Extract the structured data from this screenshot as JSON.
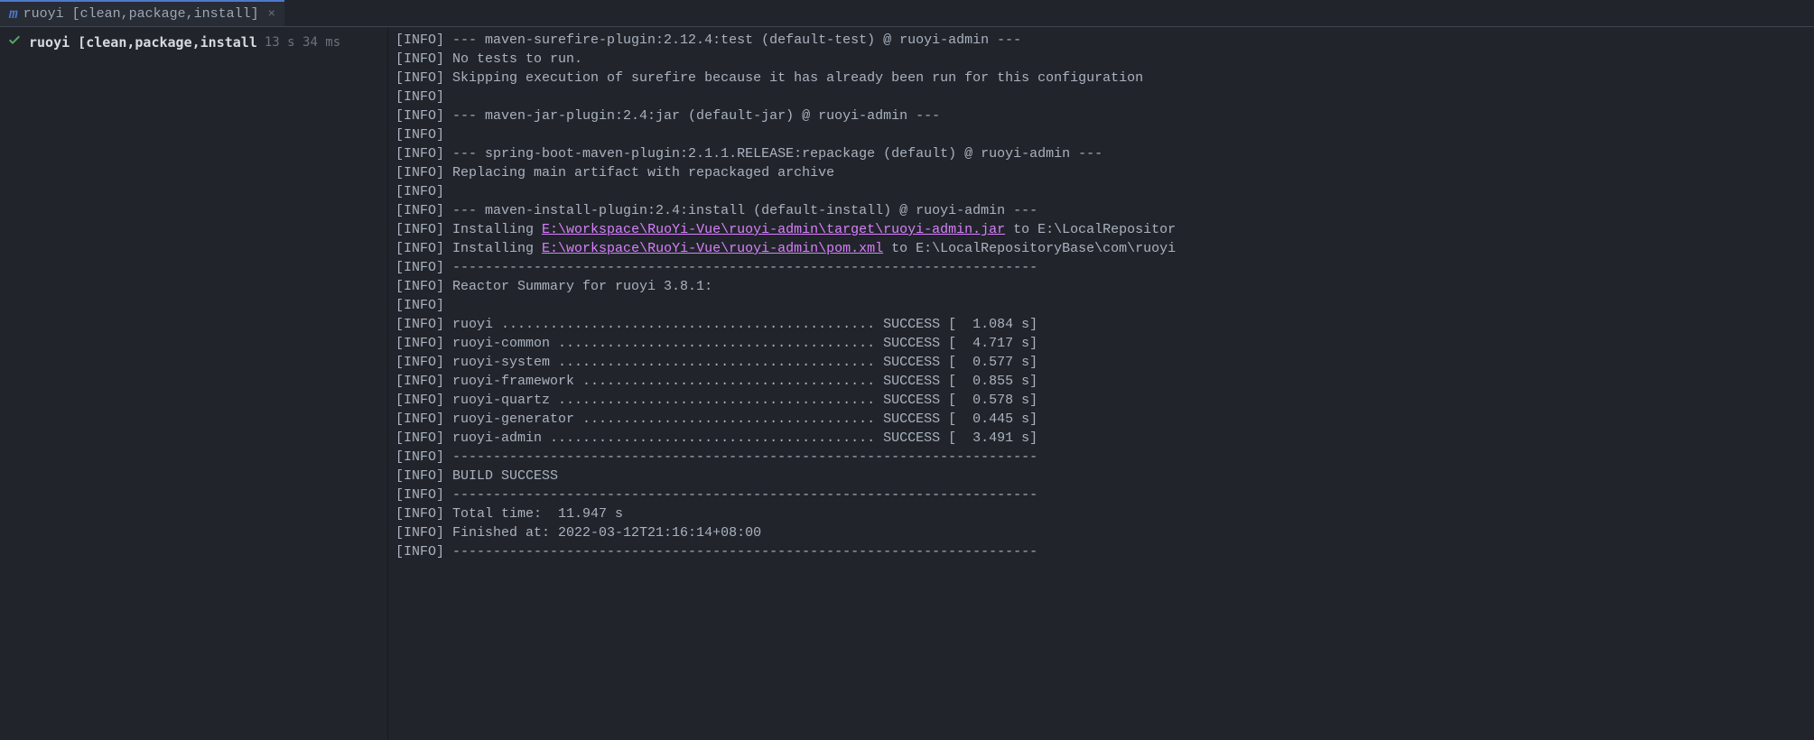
{
  "tab": {
    "title": "ruoyi [clean,package,install]",
    "close": "×"
  },
  "sidebar": {
    "run": {
      "name": "ruoyi [clean,package,install",
      "time": "13 s 34 ms"
    }
  },
  "console": {
    "lines": [
      {
        "tag": "[INFO]",
        "text": " --- maven-surefire-plugin:2.12.4:test (default-test) @ ruoyi-admin ---"
      },
      {
        "tag": "[INFO]",
        "text": " No tests to run."
      },
      {
        "tag": "[INFO]",
        "text": " Skipping execution of surefire because it has already been run for this configuration"
      },
      {
        "tag": "[INFO]",
        "text": ""
      },
      {
        "tag": "[INFO]",
        "text": " --- maven-jar-plugin:2.4:jar (default-jar) @ ruoyi-admin ---"
      },
      {
        "tag": "[INFO]",
        "text": ""
      },
      {
        "tag": "[INFO]",
        "text": " --- spring-boot-maven-plugin:2.1.1.RELEASE:repackage (default) @ ruoyi-admin ---"
      },
      {
        "tag": "[INFO]",
        "text": " Replacing main artifact with repackaged archive"
      },
      {
        "tag": "[INFO]",
        "text": ""
      },
      {
        "tag": "[INFO]",
        "text": " --- maven-install-plugin:2.4:install (default-install) @ ruoyi-admin ---"
      },
      {
        "tag": "[INFO]",
        "text": " Installing ",
        "link": "E:\\workspace\\RuoYi-Vue\\ruoyi-admin\\target\\ruoyi-admin.jar",
        "after": " to E:\\LocalRepositor"
      },
      {
        "tag": "[INFO]",
        "text": " Installing ",
        "link": "E:\\workspace\\RuoYi-Vue\\ruoyi-admin\\pom.xml",
        "after": " to E:\\LocalRepositoryBase\\com\\ruoyi"
      },
      {
        "tag": "[INFO]",
        "text": " ------------------------------------------------------------------------"
      },
      {
        "tag": "[INFO]",
        "text": " Reactor Summary for ruoyi 3.8.1:"
      },
      {
        "tag": "[INFO]",
        "text": ""
      },
      {
        "tag": "[INFO]",
        "text": " ruoyi .............................................. SUCCESS [  1.084 s]"
      },
      {
        "tag": "[INFO]",
        "text": " ruoyi-common ....................................... SUCCESS [  4.717 s]"
      },
      {
        "tag": "[INFO]",
        "text": " ruoyi-system ....................................... SUCCESS [  0.577 s]"
      },
      {
        "tag": "[INFO]",
        "text": " ruoyi-framework .................................... SUCCESS [  0.855 s]"
      },
      {
        "tag": "[INFO]",
        "text": " ruoyi-quartz ....................................... SUCCESS [  0.578 s]"
      },
      {
        "tag": "[INFO]",
        "text": " ruoyi-generator .................................... SUCCESS [  0.445 s]"
      },
      {
        "tag": "[INFO]",
        "text": " ruoyi-admin ........................................ SUCCESS [  3.491 s]"
      },
      {
        "tag": "[INFO]",
        "text": " ------------------------------------------------------------------------"
      },
      {
        "tag": "[INFO]",
        "text": " BUILD SUCCESS"
      },
      {
        "tag": "[INFO]",
        "text": " ------------------------------------------------------------------------"
      },
      {
        "tag": "[INFO]",
        "text": " Total time:  11.947 s"
      },
      {
        "tag": "[INFO]",
        "text": " Finished at: 2022-03-12T21:16:14+08:00"
      },
      {
        "tag": "[INFO]",
        "text": " ------------------------------------------------------------------------"
      }
    ]
  }
}
